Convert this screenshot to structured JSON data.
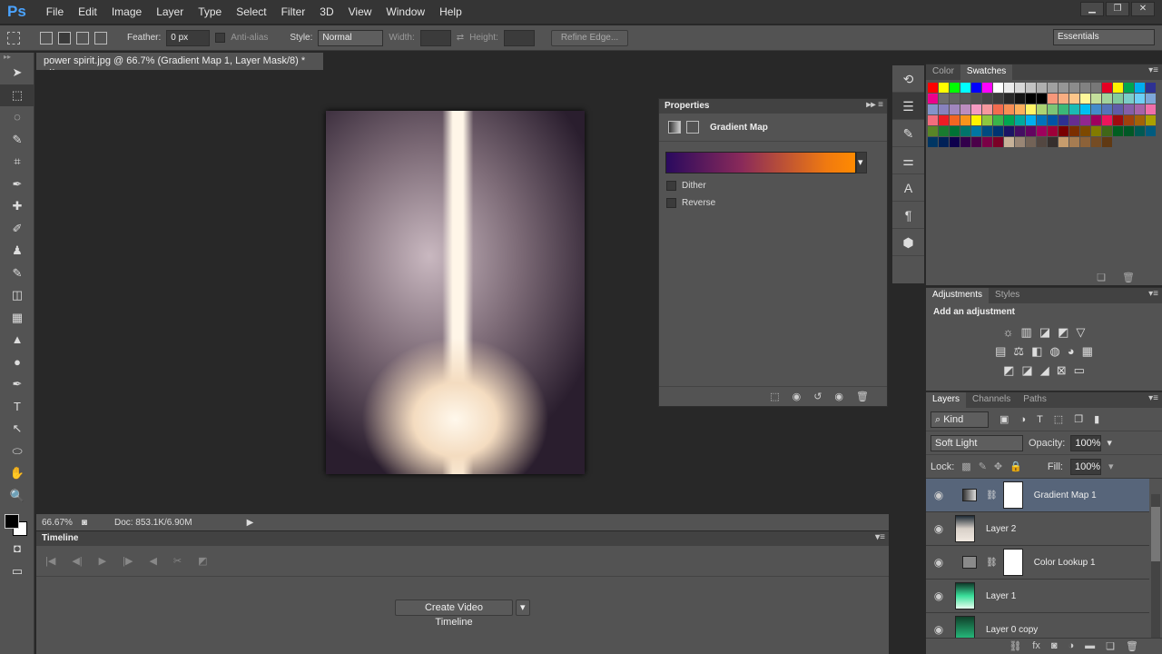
{
  "app": {
    "logo": "Ps",
    "menus": [
      "File",
      "Edit",
      "Image",
      "Layer",
      "Type",
      "Select",
      "Filter",
      "3D",
      "View",
      "Window",
      "Help"
    ],
    "window_buttons": [
      "▁",
      "❐",
      "✕"
    ]
  },
  "options": {
    "feather_label": "Feather:",
    "feather_value": "0 px",
    "antialias_label": "Anti-alias",
    "style_label": "Style:",
    "style_value": "Normal",
    "width_label": "Width:",
    "height_label": "Height:",
    "refine_edge": "Refine Edge...",
    "workspace": "Essentials"
  },
  "document": {
    "tab_title": "power spirit.jpg @ 66.7% (Gradient Map 1, Layer Mask/8) *",
    "close": "×",
    "zoom": "66.67%",
    "doc_info": "Doc: 853.1K/6.90M"
  },
  "tools": [
    "➤",
    "⬚",
    "◌",
    "✎",
    "⌗",
    "✒",
    "✚",
    "✐",
    "♟",
    "✎",
    "◫",
    "▦",
    "▲",
    "●",
    "✒",
    "T",
    "↖",
    "⬭",
    "✋",
    "🔍"
  ],
  "timeline": {
    "title": "Timeline",
    "create_button": "Create Video Timeline"
  },
  "properties": {
    "title": "Properties",
    "type": "Gradient Map",
    "gradient": {
      "from": "#2a0a5e",
      "to": "#ff8a00"
    },
    "dither": {
      "label": "Dither",
      "checked": false
    },
    "reverse": {
      "label": "Reverse",
      "checked": false
    }
  },
  "swatches_panel": {
    "tabs": [
      "Color",
      "Swatches"
    ],
    "active": "Swatches",
    "colors": [
      "#ff0000",
      "#ffff00",
      "#00ff00",
      "#00ffff",
      "#0000ff",
      "#ff00ff",
      "#ffffff",
      "#ebebeb",
      "#d7d7d7",
      "#c3c3c3",
      "#afafaf",
      "#a0a0a0",
      "#969696",
      "#8c8c8c",
      "#828282",
      "#787878",
      "#e60023",
      "#fff200",
      "#00a650",
      "#00aeef",
      "#2e3192",
      "#ec008c",
      "#6e6e6e",
      "#646464",
      "#5a5a5a",
      "#505050",
      "#464646",
      "#3c3c3c",
      "#282828",
      "#141414",
      "#000000",
      "#000000",
      "#f7977a",
      "#f9ad81",
      "#fdc68a",
      "#fff79a",
      "#c4df9b",
      "#a3d39c",
      "#82ca9d",
      "#7bcdc8",
      "#6ecff6",
      "#7ea7d8",
      "#8493ca",
      "#8882be",
      "#a187be",
      "#bc8dbf",
      "#f49ac2",
      "#f6989d",
      "#f26c4f",
      "#f68e55",
      "#fbaf5c",
      "#fff467",
      "#acd372",
      "#7cc576",
      "#3bb878",
      "#1abbb4",
      "#00bff3",
      "#438ccb",
      "#5574b9",
      "#605ca8",
      "#855fa8",
      "#a763a8",
      "#f06ea9",
      "#f26d7d",
      "#ed1c24",
      "#f26522",
      "#f7941d",
      "#fff200",
      "#8dc73f",
      "#39b54a",
      "#00a651",
      "#00a99d",
      "#00aeef",
      "#0072bc",
      "#0054a6",
      "#2e3192",
      "#662d91",
      "#92278f",
      "#9e005d",
      "#ed145b",
      "#9e0b0f",
      "#a0410d",
      "#a36209",
      "#aba000",
      "#598527",
      "#1a7b30",
      "#007236",
      "#00746b",
      "#0076a3",
      "#004b80",
      "#003471",
      "#1b1464",
      "#440e62",
      "#630460",
      "#9e005d",
      "#9e0039",
      "#790000",
      "#7b2e00",
      "#7d4900",
      "#827b00",
      "#406618",
      "#005e20",
      "#005826",
      "#005952",
      "#005b7f",
      "#003663",
      "#002157",
      "#0d004c",
      "#32004b",
      "#4b0049",
      "#7b0046",
      "#7a0026",
      "#c7b299",
      "#998675",
      "#736357",
      "#534741",
      "#362f2d",
      "#c69c6d",
      "#a67c52",
      "#8c6239",
      "#754c24",
      "#603913"
    ]
  },
  "adjustments_panel": {
    "tabs": [
      "Adjustments",
      "Styles"
    ],
    "heading": "Add an adjustment",
    "rows": [
      [
        "☼",
        "▥",
        "◪",
        "◩",
        "▽"
      ],
      [
        "▤",
        "⚖",
        "◧",
        "◍",
        "◕",
        "▦"
      ],
      [
        "◩",
        "◪",
        "◢",
        "⊠",
        "▭"
      ]
    ]
  },
  "layers_panel": {
    "tabs": [
      "Layers",
      "Channels",
      "Paths"
    ],
    "filter": "Kind",
    "blend_mode": "Soft Light",
    "opacity_label": "Opacity:",
    "opacity": "100%",
    "lock_label": "Lock:",
    "fill_label": "Fill:",
    "fill": "100%",
    "layers": [
      {
        "name": "Gradient Map 1",
        "kind": "adjustment",
        "thumb": "linear-gradient(90deg,#333,#ddd)",
        "mask": true,
        "selected": true
      },
      {
        "name": "Layer 2",
        "kind": "pixel",
        "thumb": "linear-gradient(180deg,#1e2a35,#d8d0c8,#f0e8e0)",
        "mask": false,
        "selected": false
      },
      {
        "name": "Color Lookup 1",
        "kind": "adjustment",
        "thumb": "#8a8a8a",
        "mask": true,
        "selected": false
      },
      {
        "name": "Layer 1",
        "kind": "pixel",
        "thumb": "linear-gradient(180deg,#0f3a2a,#3adf9a,#e8fff0)",
        "mask": false,
        "selected": false
      },
      {
        "name": "Layer 0 copy",
        "kind": "pixel",
        "thumb": "linear-gradient(180deg,#10402a,#2acf8a)",
        "mask": false,
        "selected": false
      }
    ],
    "footer_icons": [
      "⛓",
      "fx",
      "◙",
      "◑",
      "▬",
      "❏",
      "🗑"
    ]
  }
}
